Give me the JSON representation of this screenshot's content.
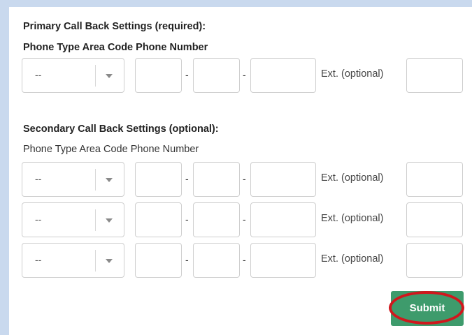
{
  "primary": {
    "heading": "Primary Call Back Settings (required):",
    "columns_label": "Phone Type Area Code Phone Number",
    "rows": [
      {
        "phone_type": "--",
        "ext_label": "Ext. (optional)",
        "area_code": "",
        "prefix": "",
        "number": "",
        "ext": ""
      }
    ]
  },
  "secondary": {
    "heading": "Secondary Call Back Settings (optional):",
    "columns_label": "Phone Type Area Code Phone Number",
    "rows": [
      {
        "phone_type": "--",
        "ext_label": "Ext. (optional)",
        "area_code": "",
        "prefix": "",
        "number": "",
        "ext": ""
      },
      {
        "phone_type": "--",
        "ext_label": "Ext. (optional)",
        "area_code": "",
        "prefix": "",
        "number": "",
        "ext": ""
      },
      {
        "phone_type": "--",
        "ext_label": "Ext. (optional)",
        "area_code": "",
        "prefix": "",
        "number": "",
        "ext": ""
      }
    ]
  },
  "separator": "-",
  "submit_label": "Submit",
  "colors": {
    "submit_bg": "#3e9b6c",
    "highlight": "#d0171d",
    "page_border": "#c9d9ee"
  }
}
